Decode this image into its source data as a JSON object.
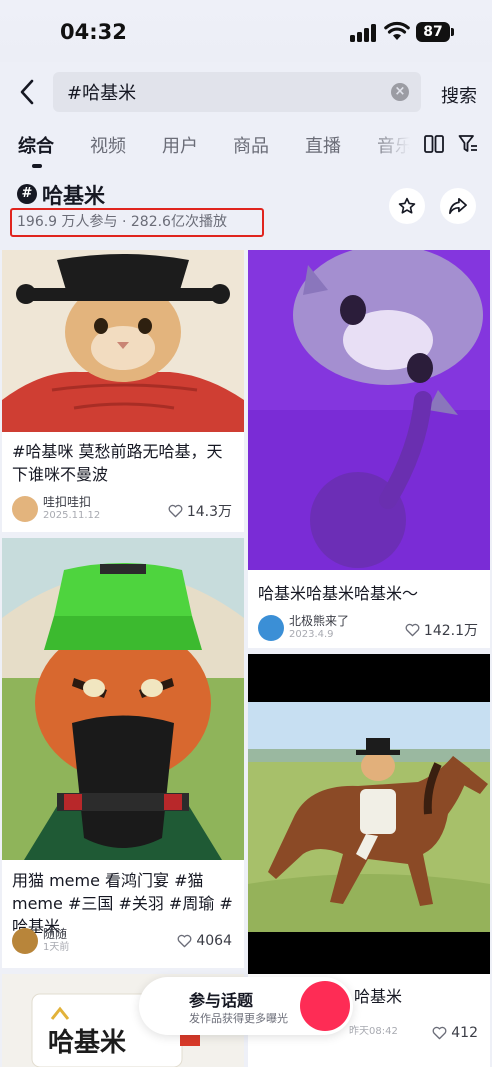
{
  "status_bar": {
    "time": "04:32",
    "battery": "87"
  },
  "search": {
    "query": "#哈基米",
    "submit_label": "搜索"
  },
  "tabs": [
    {
      "label": "综合",
      "active": true
    },
    {
      "label": "视频",
      "active": false
    },
    {
      "label": "用户",
      "active": false
    },
    {
      "label": "商品",
      "active": false
    },
    {
      "label": "直播",
      "active": false
    },
    {
      "label": "音乐",
      "active": false
    }
  ],
  "topic": {
    "title": "哈基米",
    "stats": "196.9 万人参与 · 282.6亿次播放"
  },
  "cards": [
    {
      "title": "#哈基咪 莫愁前路无哈基，天下谁咪不曼波",
      "user": "哇扣哇扣",
      "date": "2025.11.12",
      "likes": "14.3万"
    },
    {
      "title": "哈基米哈基米哈基米～",
      "user": "北极熊来了",
      "date": "2023.4.9",
      "likes": "142.1万"
    },
    {
      "title": "用猫 meme 看鸿门宴 #猫 meme #三国 #关羽 #周瑜 #哈基米",
      "user": "随随",
      "date": "1天前",
      "likes": "4064"
    },
    {
      "title": "哈基米",
      "user": "",
      "date": "昨天08:42",
      "likes": "412"
    }
  ],
  "cta": {
    "title": "参与话题",
    "subtitle": "发作品获得更多曝光"
  },
  "thumbnail_texts": {
    "package_label": "哈基米"
  },
  "colors": {
    "accent_red": "#fe2c55",
    "highlight_box": "#e0241e",
    "text_primary": "#161823",
    "text_secondary": "#6b6d78"
  }
}
